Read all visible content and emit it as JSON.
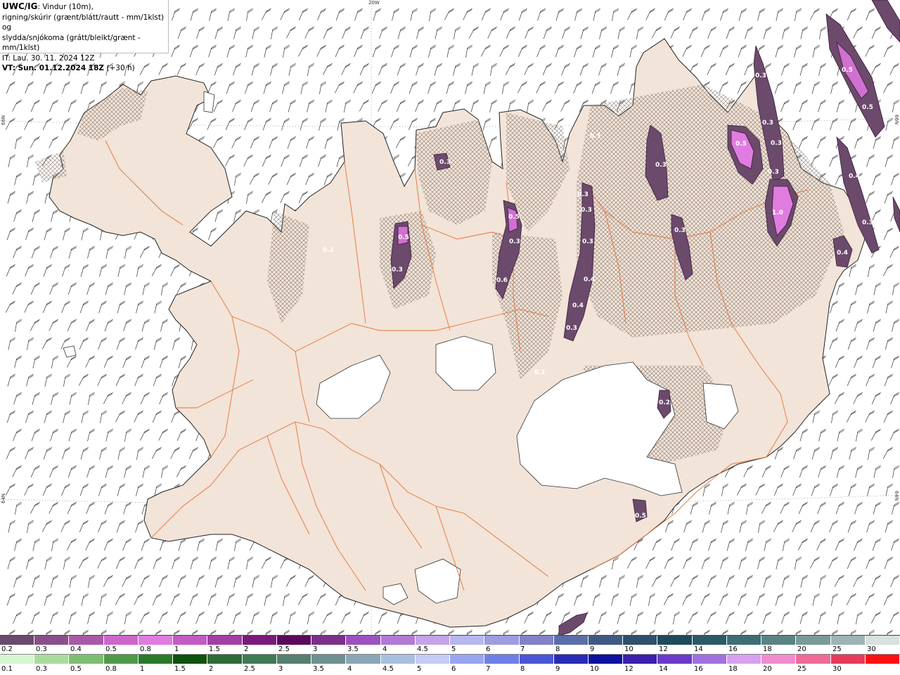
{
  "header": {
    "product": "UWC/IG",
    "line1_rest": ": Vindur (10m),",
    "line2": "rigning/skúrir (grænt/blátt/rautt - mm/1klst) og",
    "line3": "slydda/snjókoma (grátt/bleikt/grænt - mm/1klst)",
    "line4": "IT: Lau. 30. 11. 2024 12Z",
    "line5_label": "VT: Sun. 01.12.2024 18Z",
    "line5_rest": " (+30 h)"
  },
  "grid_labels": {
    "top": "20W",
    "left_upper": "66N",
    "left_lower": "64N",
    "right_upper": "66N",
    "right_lower": "64N"
  },
  "precip_labels": [
    "0.3",
    "0.5",
    "0.3",
    "0.1",
    "0.5",
    "0.3",
    "0.6",
    "0.3",
    "0.3",
    "0.3",
    "0.4",
    "0.4",
    "0.3",
    "0.1",
    "0.1",
    "0.3",
    "0.3",
    "0.3",
    "0.3",
    "0.3",
    "0.5",
    "0.3",
    "1.0",
    "0.5",
    "0.5",
    "0.4",
    "0.3",
    "0.4",
    "0.2",
    "0.5"
  ],
  "legend_snow": {
    "colors": [
      "#6b4a6b",
      "#8a4f8a",
      "#a85aa8",
      "#cc66cc",
      "#e07ce0",
      "#c45ac4",
      "#a33fa3",
      "#7a1a7a",
      "#5a0a5a",
      "#7d2f8a",
      "#9b52c0",
      "#b07ad6",
      "#c4a3e8",
      "#b7b7f0",
      "#9d9de0",
      "#8282c8",
      "#5a6ea8",
      "#3e5a82",
      "#2f4f6b",
      "#1f4a5a",
      "#2a5a66",
      "#3d6e75",
      "#5a8484",
      "#7a9a9a",
      "#9fb4b4",
      "#d8e0e0"
    ],
    "labels": [
      "0.2",
      "0.3",
      "0.4",
      "0.5",
      "0.8",
      "1",
      "1.5",
      "2",
      "2.5",
      "3",
      "3.5",
      "4",
      "4.5",
      "5",
      "6",
      "7",
      "8",
      "9",
      "10",
      "12",
      "14",
      "16",
      "18",
      "20",
      "25",
      "30"
    ]
  },
  "legend_rain": {
    "colors": [
      "#d7f5d0",
      "#a8dc9c",
      "#7dbf72",
      "#4f9a48",
      "#2a7a2a",
      "#0d520d",
      "#2e6a3a",
      "#3e7a54",
      "#557f6e",
      "#6f9090",
      "#8aa7b5",
      "#a9bfe0",
      "#c5ccf5",
      "#9aa5f0",
      "#6f7fe6",
      "#4a55d6",
      "#2a2ab8",
      "#0f0fa0",
      "#3a1fb0",
      "#6a3acc",
      "#a070e0",
      "#d8a0f0",
      "#f08ccd",
      "#f06a9a",
      "#e83a5a",
      "#ff1010"
    ],
    "labels": [
      "0.1",
      "0.3",
      "0.5",
      "0.8",
      "1",
      "1.5",
      "2",
      "2.5",
      "3",
      "3.5",
      "4",
      "4.5",
      "5",
      "6",
      "7",
      "8",
      "9",
      "10",
      "12",
      "14",
      "16",
      "18",
      "20",
      "25",
      "30"
    ]
  }
}
